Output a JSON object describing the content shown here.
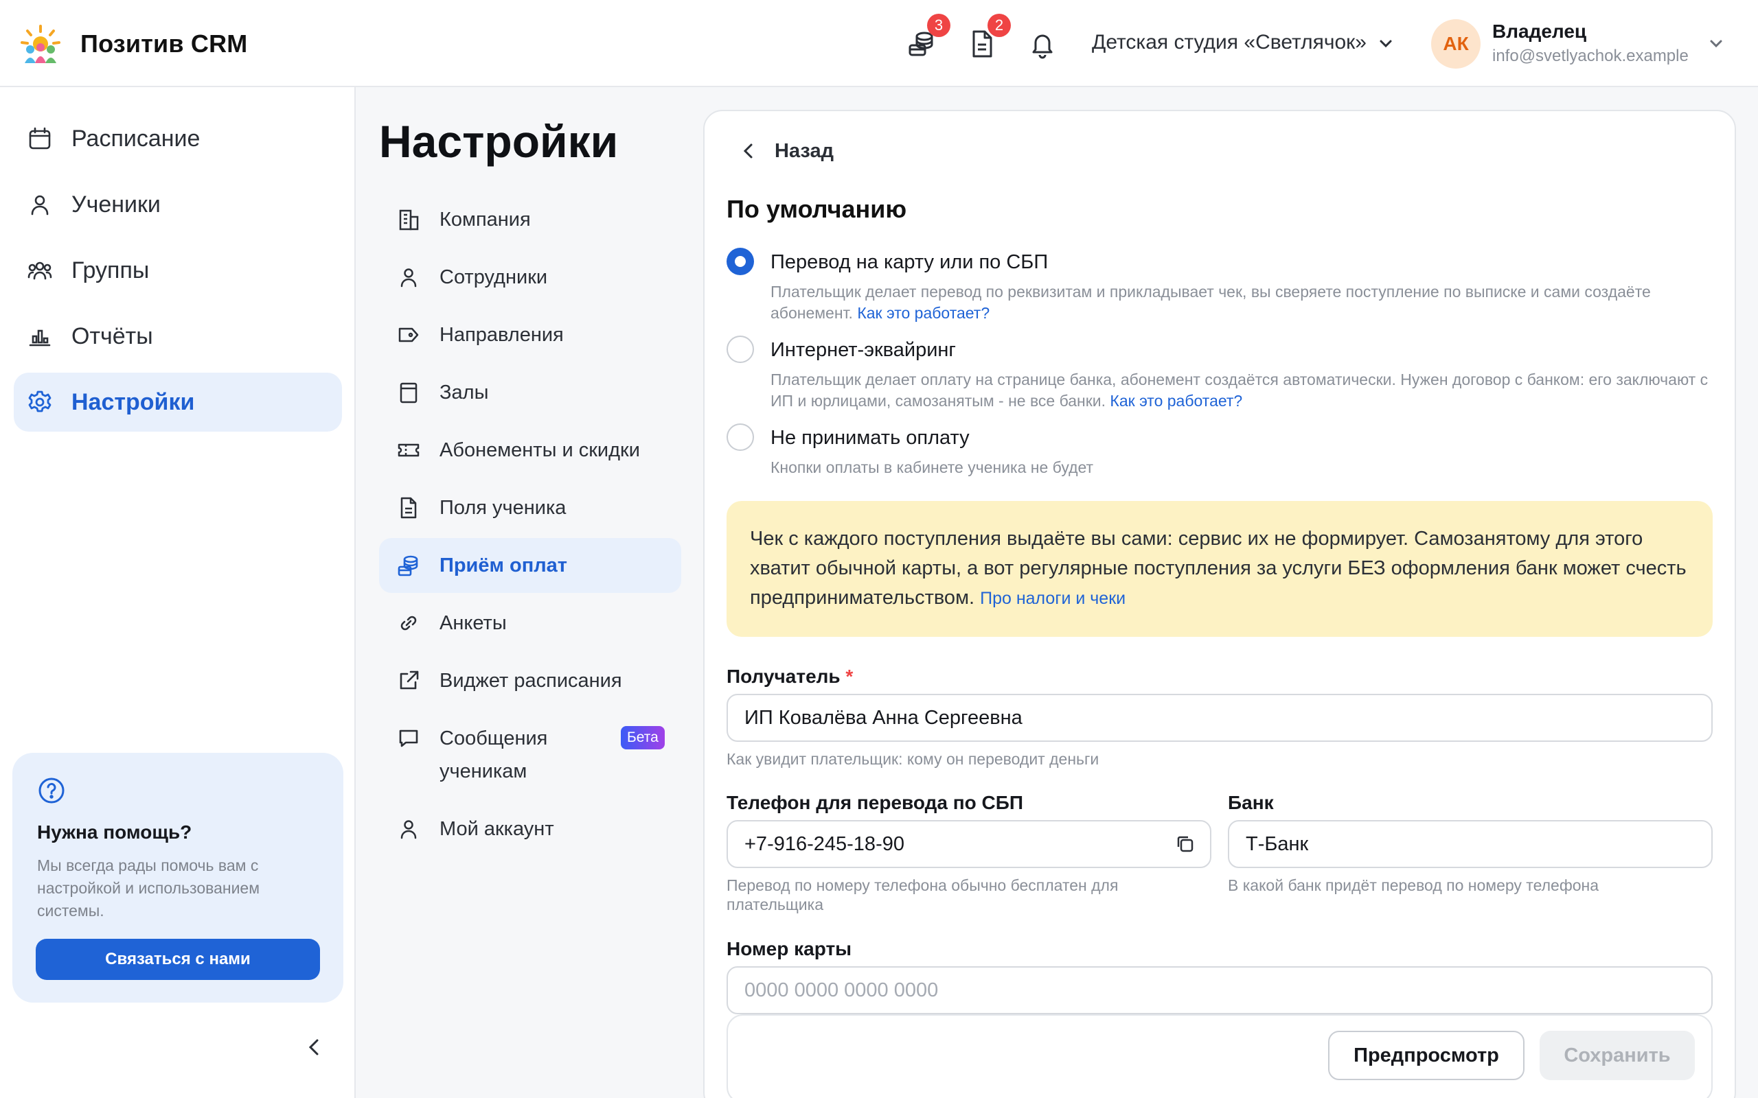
{
  "header": {
    "brand": "Позитив CRM",
    "icons": [
      {
        "name": "payments-icon",
        "badge": "3"
      },
      {
        "name": "document-icon",
        "badge": "2"
      },
      {
        "name": "bell-icon",
        "badge": ""
      }
    ],
    "studio": "Детская студия «Светлячок»",
    "user": {
      "initials": "АК",
      "role": "Владелец",
      "email": "info@svetlyachok.example"
    }
  },
  "sidebar": {
    "items": [
      {
        "label": "Расписание",
        "icon": "calendar-icon",
        "active": false
      },
      {
        "label": "Ученики",
        "icon": "user-icon",
        "active": false
      },
      {
        "label": "Группы",
        "icon": "users-icon",
        "active": false
      },
      {
        "label": "Отчёты",
        "icon": "chart-icon",
        "active": false
      },
      {
        "label": "Настройки",
        "icon": "gear-icon",
        "active": true
      }
    ],
    "help": {
      "title": "Нужна помощь?",
      "text": "Мы всегда рады помочь вам с настройкой и использованием системы.",
      "button": "Связаться с нами"
    }
  },
  "settings": {
    "title": "Настройки",
    "items": [
      {
        "label": "Компания",
        "icon": "building-icon"
      },
      {
        "label": "Сотрудники",
        "icon": "user-icon"
      },
      {
        "label": "Направления",
        "icon": "tag-icon"
      },
      {
        "label": "Залы",
        "icon": "door-icon"
      },
      {
        "label": "Абонементы и скидки",
        "icon": "ticket-icon"
      },
      {
        "label": "Поля ученика",
        "icon": "file-icon"
      },
      {
        "label": "Приём оплат",
        "icon": "coins-icon"
      },
      {
        "label": "Анкеты",
        "icon": "link-icon"
      },
      {
        "label": "Виджет расписания",
        "icon": "external-link-icon"
      },
      {
        "label": "Сообщения",
        "label2": "ученикам",
        "icon": "message-icon",
        "badge": "Бета"
      },
      {
        "label": "Мой аккаунт",
        "icon": "user-icon"
      }
    ],
    "active_index": 6
  },
  "main": {
    "back": "Назад",
    "section": "По умолчанию",
    "options": [
      {
        "title": "Перевод на карту или по СБП",
        "desc": "Плательщик делает перевод по реквизитам и прикладывает чек, вы сверяете поступление по выписке и сами создаёте абонемент.",
        "link": "Как это работает?",
        "selected": true
      },
      {
        "title": "Интернет-эквайринг",
        "desc": "Плательщик делает оплату на странице банка, абонемент создаётся автоматически. Нужен договор с банком: его заключают с ИП и юрлицами, самозанятым - не все банки.",
        "link": "Как это работает?",
        "selected": false
      },
      {
        "title": "Не принимать оплату",
        "desc": "Кнопки оплаты в кабинете ученика не будет",
        "link": "",
        "selected": false
      }
    ],
    "warning": {
      "text": "Чек с каждого поступления выдаёте вы сами: сервис их не формирует. Самозанятому для этого хватит обычной карты, а вот регулярные поступления за услуги БЕЗ оформления банк может счесть предпринимательством.",
      "link": "Про налоги и чеки"
    },
    "recipient": {
      "label": "Получатель",
      "required": "*",
      "value": "ИП Ковалёва Анна Сергеевна",
      "hint": "Как увидит плательщик: кому он переводит деньги"
    },
    "phone": {
      "label": "Телефон для перевода по СБП",
      "value": "+7-916-245-18-90",
      "hint": "Перевод по номеру телефона обычно бесплатен для плательщика"
    },
    "bank": {
      "label": "Банк",
      "value": "Т-Банк",
      "hint": "В какой банк придёт перевод по номеру телефона"
    },
    "card": {
      "label": "Номер карты",
      "placeholder": "0000 0000 0000 0000"
    },
    "buttons": {
      "preview": "Предпросмотр",
      "save": "Сохранить"
    }
  },
  "colors": {
    "accent": "#1f63d6",
    "active_bg": "#e8f0fc",
    "warning_bg": "#fdf2c4",
    "badge": "#ef4444",
    "avatar_bg": "#fde4cc",
    "avatar_text": "#e2620f"
  }
}
